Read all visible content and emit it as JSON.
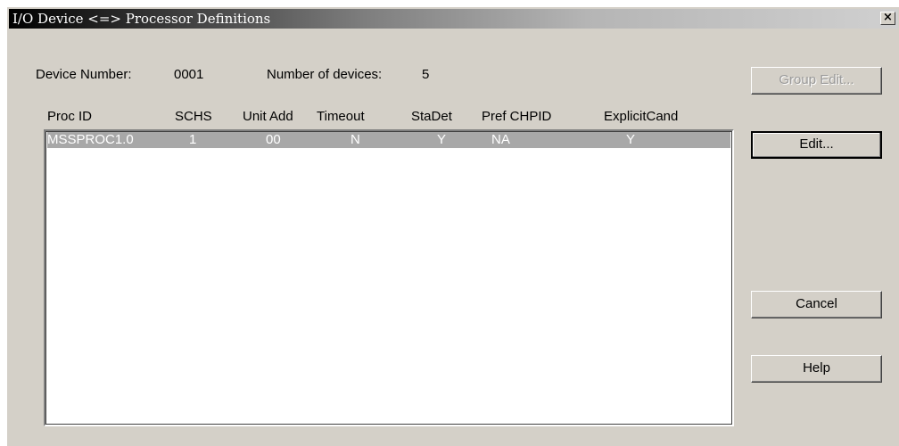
{
  "window": {
    "title": "I/O Device <=> Processor Definitions",
    "close_glyph": "×"
  },
  "device_info": {
    "device_number_label": "Device Number:",
    "device_number_value": "0001",
    "num_devices_label": "Number of devices:",
    "num_devices_value": "5"
  },
  "table": {
    "columns": [
      "Proc ID",
      "SCHS",
      "Unit Add",
      "Timeout",
      "StaDet",
      "Pref CHPID",
      "ExplicitCand"
    ],
    "rows": [
      [
        "MSSPROC1.0",
        "1",
        "00",
        "N",
        "Y",
        "NA",
        "Y"
      ]
    ]
  },
  "buttons": {
    "group_edit": "Group Edit...",
    "edit": "Edit...",
    "cancel": "Cancel",
    "help": "Help"
  },
  "colors": {
    "dialog_bg": "#d4d0c8",
    "selected_row": "#a8a8a8"
  }
}
